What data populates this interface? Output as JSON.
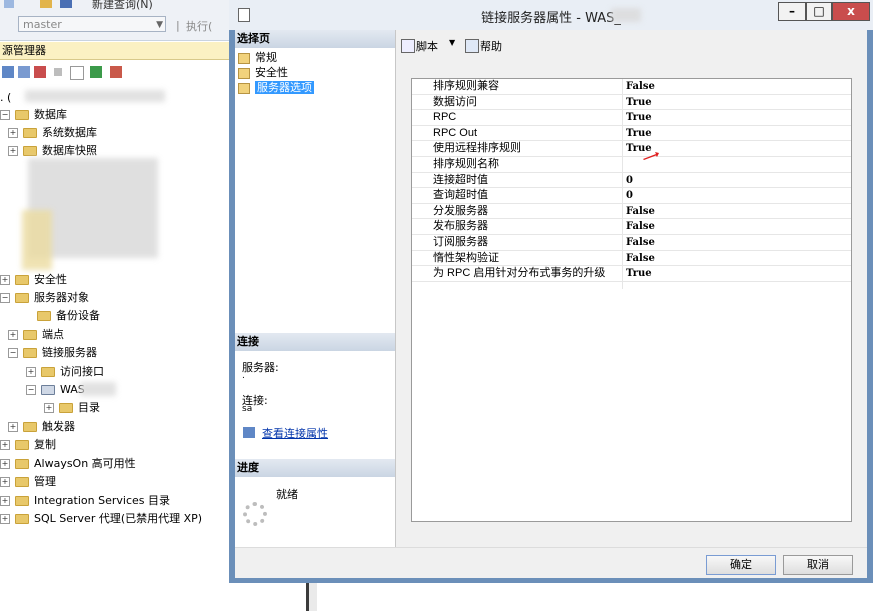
{
  "background": {
    "toolbar": {
      "new_query_label": "新建查询(N)",
      "database_select": "master",
      "execute_label": "执行("
    },
    "object_explorer": {
      "title": "源管理器",
      "server_prefix": ". (",
      "tree": [
        {
          "label": "数据库",
          "expand": "−"
        },
        {
          "label": "系统数据库",
          "expand": "+"
        },
        {
          "label": "数据库快照",
          "expand": "+"
        },
        {
          "label": "安全性",
          "expand": "+"
        },
        {
          "label": "服务器对象",
          "expand": "−"
        },
        {
          "label": "备份设备",
          "expand": ""
        },
        {
          "label": "端点",
          "expand": "+"
        },
        {
          "label": "链接服务器",
          "expand": "−"
        },
        {
          "label": "访问接口",
          "expand": "+"
        },
        {
          "label": "WAS",
          "expand": "−"
        },
        {
          "label": "目录",
          "expand": "+"
        },
        {
          "label": "触发器",
          "expand": "+"
        },
        {
          "label": "复制",
          "expand": "+"
        },
        {
          "label": "AlwaysOn 高可用性",
          "expand": "+"
        },
        {
          "label": "管理",
          "expand": "+"
        },
        {
          "label": "Integration Services 目录",
          "expand": "+"
        },
        {
          "label": "SQL Server 代理(已禁用代理 XP)",
          "expand": "+"
        }
      ]
    }
  },
  "dialog": {
    "title": "链接服务器属性 - WAS_",
    "window_buttons": {
      "minimize": "–",
      "maximize": "□",
      "close": "x"
    },
    "select_page": {
      "heading": "选择页",
      "items": [
        "常规",
        "安全性",
        "服务器选项"
      ],
      "selected_index": 2
    },
    "connection": {
      "heading": "连接",
      "server_label": "服务器:",
      "server_value": ".",
      "connection_label": "连接:",
      "connection_value": "sa",
      "view_link": "查看连接属性"
    },
    "progress": {
      "heading": "进度",
      "status": "就绪"
    },
    "toolbar": {
      "script_label": "脚本",
      "help_label": "帮助"
    },
    "options": [
      {
        "name": "排序规则兼容",
        "value": "False"
      },
      {
        "name": "数据访问",
        "value": "True"
      },
      {
        "name": "RPC",
        "value": "True"
      },
      {
        "name": "RPC Out",
        "value": "True"
      },
      {
        "name": "使用远程排序规则",
        "value": "True"
      },
      {
        "name": "排序规则名称",
        "value": ""
      },
      {
        "name": "连接超时值",
        "value": "0"
      },
      {
        "name": "查询超时值",
        "value": "0"
      },
      {
        "name": "分发服务器",
        "value": "False"
      },
      {
        "name": "发布服务器",
        "value": "False"
      },
      {
        "name": "订阅服务器",
        "value": "False"
      },
      {
        "name": "惰性架构验证",
        "value": "False"
      },
      {
        "name": "为 RPC 启用针对分布式事务的升级",
        "value": "True"
      }
    ],
    "buttons": {
      "ok": "确定",
      "cancel": "取消"
    }
  },
  "colors": {
    "dialog_border": "#6b8fb9",
    "selection": "#3399ff",
    "arrow": "#e02020",
    "link": "#0033aa"
  }
}
